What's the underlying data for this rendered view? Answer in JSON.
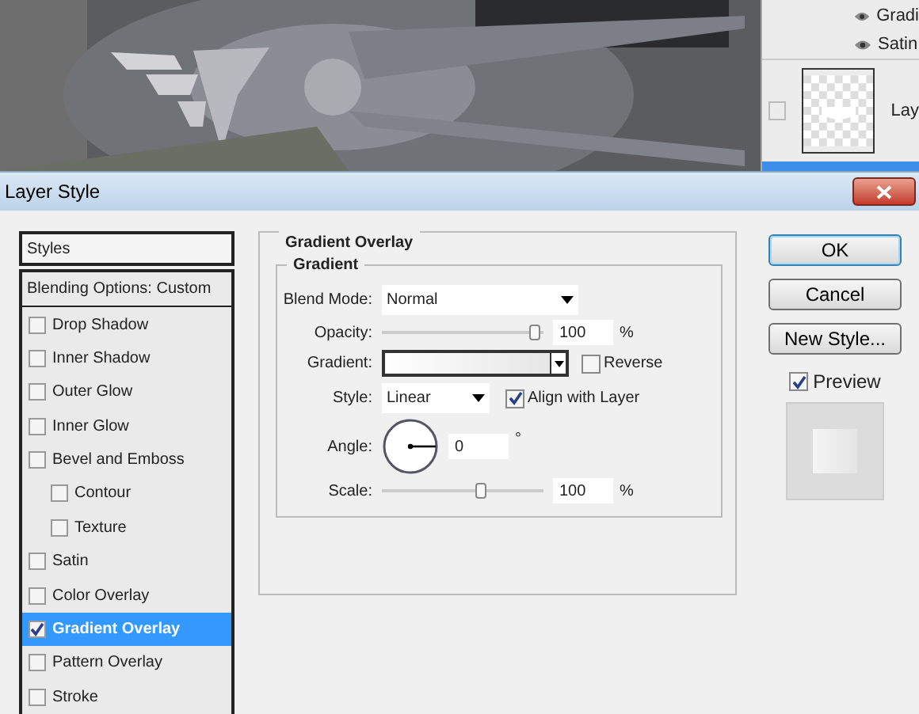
{
  "layers_panel": {
    "effects": [
      {
        "label": "Gradi",
        "visible": true
      },
      {
        "label": "Satin",
        "visible": true
      }
    ],
    "layer": {
      "label": "Lay",
      "linked": false
    }
  },
  "dialog": {
    "title": "Layer Style",
    "styles_list": {
      "header": "Styles",
      "blending": "Blending Options: Custom",
      "items": [
        {
          "label": "Drop Shadow",
          "checked": false,
          "selected": false
        },
        {
          "label": "Inner Shadow",
          "checked": false,
          "selected": false
        },
        {
          "label": "Outer Glow",
          "checked": false,
          "selected": false
        },
        {
          "label": "Inner Glow",
          "checked": false,
          "selected": false
        },
        {
          "label": "Bevel and Emboss",
          "checked": false,
          "selected": false,
          "children": [
            {
              "label": "Contour",
              "checked": false,
              "selected": false
            },
            {
              "label": "Texture",
              "checked": false,
              "selected": false
            }
          ]
        },
        {
          "label": "Satin",
          "checked": false,
          "selected": false
        },
        {
          "label": "Color Overlay",
          "checked": false,
          "selected": false
        },
        {
          "label": "Gradient Overlay",
          "checked": true,
          "selected": true
        },
        {
          "label": "Pattern Overlay",
          "checked": false,
          "selected": false
        },
        {
          "label": "Stroke",
          "checked": false,
          "selected": false
        }
      ]
    },
    "section": {
      "title": "Gradient Overlay",
      "group": "Gradient",
      "blend_mode": {
        "label": "Blend Mode:",
        "value": "Normal"
      },
      "opacity": {
        "label": "Opacity:",
        "level": 0.98,
        "value": "100",
        "unit": "%"
      },
      "gradient": {
        "label": "Gradient:"
      },
      "reverse": {
        "label": "Reverse",
        "checked": false
      },
      "style": {
        "label": "Style:",
        "value": "Linear"
      },
      "align": {
        "label": "Align with Layer",
        "checked": true
      },
      "angle": {
        "label": "Angle:",
        "value": "0",
        "unit": "°"
      },
      "scale": {
        "label": "Scale:",
        "level": 0.62,
        "value": "100",
        "unit": "%"
      }
    },
    "buttons": [
      {
        "label": "OK",
        "default": true
      },
      {
        "label": "Cancel",
        "default": false
      },
      {
        "label": "New Style...",
        "default": false
      }
    ],
    "preview": {
      "label": "Preview",
      "checked": true
    }
  }
}
